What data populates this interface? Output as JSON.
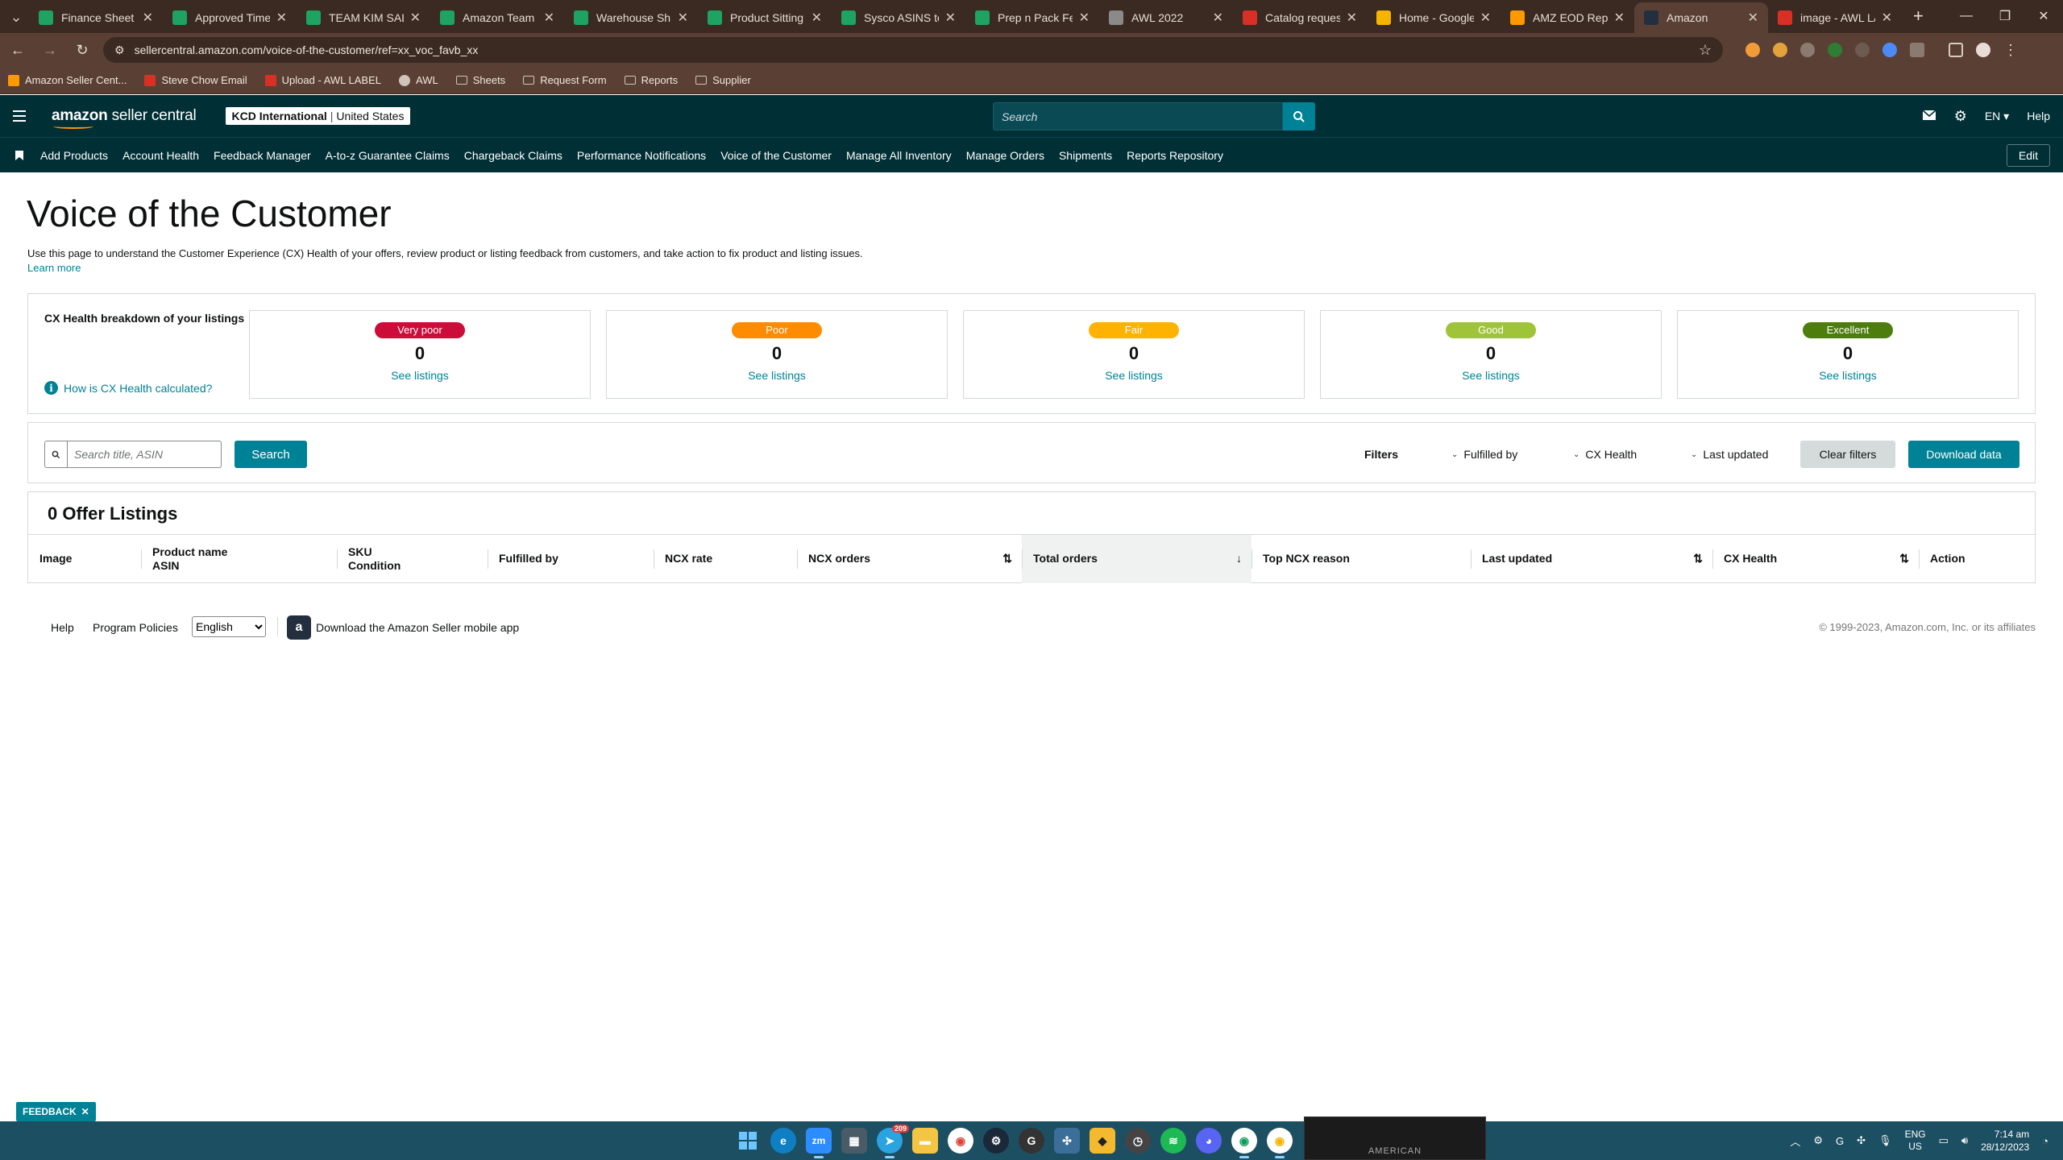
{
  "browser": {
    "tabs": [
      {
        "title": "Finance Sheet - a",
        "favicon": "sheets-icon",
        "color": "#1ea362"
      },
      {
        "title": "Approved Time Sl",
        "favicon": "sheets-icon",
        "color": "#1ea362"
      },
      {
        "title": "TEAM KIM SALES",
        "favicon": "sheets-icon",
        "color": "#1ea362"
      },
      {
        "title": "Amazon Team On",
        "favicon": "sheets-icon",
        "color": "#1ea362"
      },
      {
        "title": "Warehouse Shipp",
        "favicon": "sheets-icon",
        "color": "#1ea362"
      },
      {
        "title": "Product Sitting fo",
        "favicon": "sheets-icon",
        "color": "#1ea362"
      },
      {
        "title": "Sysco ASINS to p",
        "favicon": "sheets-icon",
        "color": "#1ea362"
      },
      {
        "title": "Prep n Pack Fees",
        "favicon": "sheets-icon",
        "color": "#1ea362"
      },
      {
        "title": "AWL 2022",
        "favicon": "globe-icon",
        "color": "#8a8a8a"
      },
      {
        "title": "Catalog request",
        "favicon": "gmail-icon",
        "color": "#d93025"
      },
      {
        "title": "Home - Google D",
        "favicon": "drive-icon",
        "color": "#f4b400"
      },
      {
        "title": "AMZ EOD Report",
        "favicon": "amazon-icon",
        "color": "#ff9900"
      },
      {
        "title": "Amazon",
        "favicon": "amazon-icon",
        "color": "#232f3e"
      },
      {
        "title": "image - AWL LAB",
        "favicon": "gmail-icon",
        "color": "#d93025"
      }
    ],
    "active_tab_index": 12,
    "url": "sellercentral.amazon.com/voice-of-the-customer/ref=xx_voc_favb_xx",
    "bookmarks": [
      {
        "label": "Amazon Seller Cent...",
        "icon": "amazon-icon"
      },
      {
        "label": "Steve Chow Email",
        "icon": "gmail-icon"
      },
      {
        "label": "Upload - AWL LABEL",
        "icon": "gmail-icon"
      },
      {
        "label": "AWL",
        "icon": "globe-icon"
      },
      {
        "label": "Sheets",
        "icon": "folder-icon"
      },
      {
        "label": "Request Form",
        "icon": "folder-icon"
      },
      {
        "label": "Reports",
        "icon": "folder-icon"
      },
      {
        "label": "Supplier",
        "icon": "folder-icon"
      }
    ]
  },
  "header": {
    "logo_text_bold": "amazon",
    "logo_text_rest": " seller central",
    "store_name": "KCD International",
    "store_marketplace": "United States",
    "search_placeholder": "Search",
    "language": "EN",
    "help": "Help",
    "accent_color": "#008296",
    "bg_color": "#002f36"
  },
  "nav": {
    "links": [
      "Add Products",
      "Account Health",
      "Feedback Manager",
      "A-to-z Guarantee Claims",
      "Chargeback Claims",
      "Performance Notifications",
      "Voice of the Customer",
      "Manage All Inventory",
      "Manage Orders",
      "Shipments",
      "Reports Repository"
    ],
    "edit": "Edit"
  },
  "page": {
    "title": "Voice of the Customer",
    "description": "Use this page to understand the Customer Experience (CX) Health of your offers, review product or listing feedback from customers, and take action to fix product and listing issues.",
    "learn_more": "Learn more"
  },
  "cx_health": {
    "label": "CX Health breakdown of your listings",
    "help_link": "How is CX Health calculated?",
    "cards": [
      {
        "status": "Very poor",
        "count": "0",
        "link": "See listings",
        "color": "#cc0c39"
      },
      {
        "status": "Poor",
        "count": "0",
        "link": "See listings",
        "color": "#fe8b00"
      },
      {
        "status": "Fair",
        "count": "0",
        "link": "See listings",
        "color": "#ffb200"
      },
      {
        "status": "Good",
        "count": "0",
        "link": "See listings",
        "color": "#9fc43a"
      },
      {
        "status": "Excellent",
        "count": "0",
        "link": "See listings",
        "color": "#4c7d0d"
      }
    ]
  },
  "filters": {
    "search_placeholder": "Search title, ASIN",
    "search_button": "Search",
    "label": "Filters",
    "dropdowns": [
      "Fulfilled by",
      "CX Health",
      "Last updated"
    ],
    "clear": "Clear filters",
    "download": "Download data"
  },
  "listings": {
    "title": "0 Offer Listings",
    "columns": [
      {
        "l1": "Image",
        "l2": "",
        "sort": ""
      },
      {
        "l1": "Product name",
        "l2": "ASIN",
        "sort": ""
      },
      {
        "l1": "SKU",
        "l2": "Condition",
        "sort": ""
      },
      {
        "l1": "Fulfilled by",
        "l2": "",
        "sort": ""
      },
      {
        "l1": "NCX rate",
        "l2": "",
        "sort": ""
      },
      {
        "l1": "NCX orders",
        "l2": "",
        "sort": "both"
      },
      {
        "l1": "Total orders",
        "l2": "",
        "sort": "desc"
      },
      {
        "l1": "Top NCX reason",
        "l2": "",
        "sort": ""
      },
      {
        "l1": "Last updated",
        "l2": "",
        "sort": "both"
      },
      {
        "l1": "CX Health",
        "l2": "",
        "sort": "both"
      },
      {
        "l1": "Action",
        "l2": "",
        "sort": ""
      }
    ]
  },
  "footer": {
    "help": "Help",
    "policies": "Program Policies",
    "language": "English",
    "app": "Download the Amazon Seller mobile app",
    "copyright": "© 1999-2023, Amazon.com, Inc. or its affiliates"
  },
  "feedback": "FEEDBACK",
  "taskbar": {
    "thumbnail_text": "AMERICAN",
    "language": "ENG",
    "region": "US",
    "time": "7:14 am",
    "date": "28/12/2023",
    "telegram_badge": "209"
  }
}
